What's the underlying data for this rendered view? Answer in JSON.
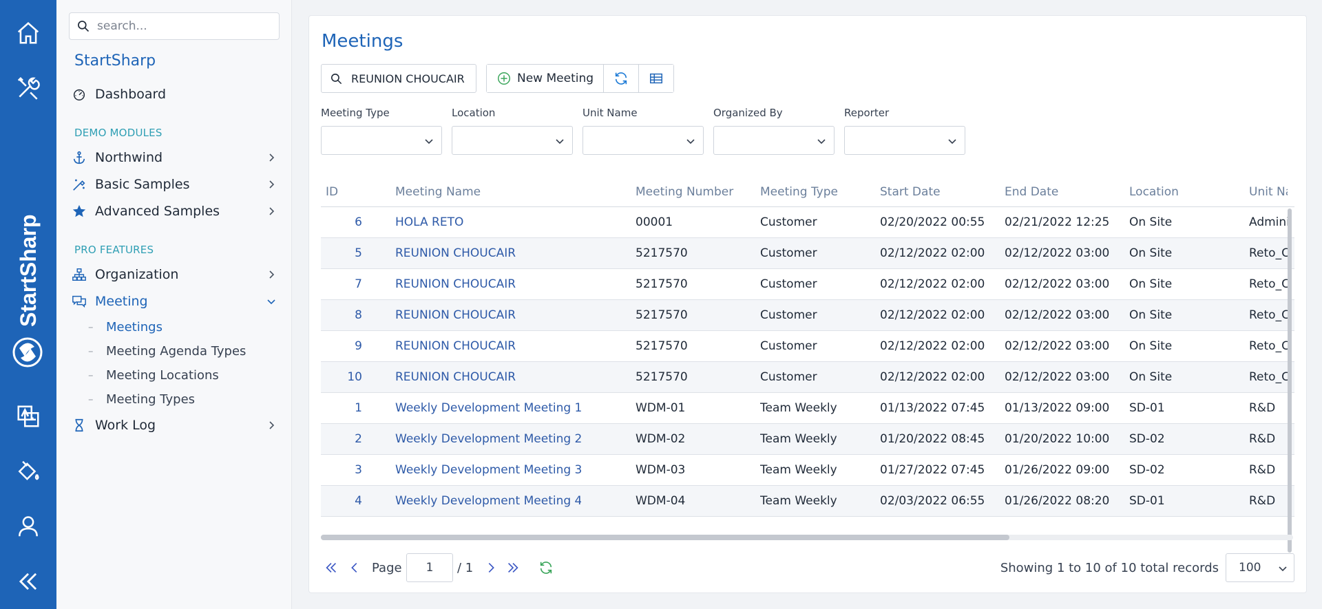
{
  "rail": {
    "brand_text": "StartSharp",
    "icons": [
      "home-icon",
      "tools-icon",
      "translate-icon",
      "paint-bucket-icon",
      "user-icon",
      "collapse-icon"
    ]
  },
  "sidebar": {
    "search_placeholder": "search...",
    "app_title": "StartSharp",
    "dashboard": "Dashboard",
    "section_demo": "DEMO MODULES",
    "northwind": "Northwind",
    "basic_samples": "Basic Samples",
    "advanced_samples": "Advanced Samples",
    "section_pro": "PRO FEATURES",
    "organization": "Organization",
    "meeting": "Meeting",
    "meeting_sub": [
      "Meetings",
      "Meeting Agenda Types",
      "Meeting Locations",
      "Meeting Types"
    ],
    "work_log": "Work Log"
  },
  "main": {
    "title": "Meetings",
    "search_value": "REUNION CHOUCAIR",
    "new_button": "New Meeting",
    "filters": [
      "Meeting Type",
      "Location",
      "Unit Name",
      "Organized By",
      "Reporter"
    ],
    "columns": [
      "ID",
      "Meeting Name",
      "Meeting Number",
      "Meeting Type",
      "Start Date",
      "End Date",
      "Location",
      "Unit Name"
    ],
    "rows": [
      {
        "id": "6",
        "name": "HOLA RETO",
        "number": "00001",
        "type": "Customer",
        "start": "02/20/2022 00:55",
        "end": "02/21/2022 12:25",
        "location": "On Site",
        "unit": "Administration"
      },
      {
        "id": "5",
        "name": "REUNION CHOUCAIR",
        "number": "5217570",
        "type": "Customer",
        "start": "02/12/2022 02:00",
        "end": "02/12/2022 03:00",
        "location": "On Site",
        "unit": "Reto_Choucair"
      },
      {
        "id": "7",
        "name": "REUNION CHOUCAIR",
        "number": "5217570",
        "type": "Customer",
        "start": "02/12/2022 02:00",
        "end": "02/12/2022 03:00",
        "location": "On Site",
        "unit": "Reto_Choucair"
      },
      {
        "id": "8",
        "name": "REUNION CHOUCAIR",
        "number": "5217570",
        "type": "Customer",
        "start": "02/12/2022 02:00",
        "end": "02/12/2022 03:00",
        "location": "On Site",
        "unit": "Reto_Choucair"
      },
      {
        "id": "9",
        "name": "REUNION CHOUCAIR",
        "number": "5217570",
        "type": "Customer",
        "start": "02/12/2022 02:00",
        "end": "02/12/2022 03:00",
        "location": "On Site",
        "unit": "Reto_Choucair"
      },
      {
        "id": "10",
        "name": "REUNION CHOUCAIR",
        "number": "5217570",
        "type": "Customer",
        "start": "02/12/2022 02:00",
        "end": "02/12/2022 03:00",
        "location": "On Site",
        "unit": "Reto_Choucair"
      },
      {
        "id": "1",
        "name": "Weekly Development Meeting 1",
        "number": "WDM-01",
        "type": "Team Weekly",
        "start": "01/13/2022 07:45",
        "end": "01/13/2022 09:00",
        "location": "SD-01",
        "unit": "R&D"
      },
      {
        "id": "2",
        "name": "Weekly Development Meeting 2",
        "number": "WDM-02",
        "type": "Team Weekly",
        "start": "01/20/2022 08:45",
        "end": "01/20/2022 10:00",
        "location": "SD-02",
        "unit": "R&D"
      },
      {
        "id": "3",
        "name": "Weekly Development Meeting 3",
        "number": "WDM-03",
        "type": "Team Weekly",
        "start": "01/27/2022 07:45",
        "end": "01/26/2022 09:00",
        "location": "SD-02",
        "unit": "R&D"
      },
      {
        "id": "4",
        "name": "Weekly Development Meeting 4",
        "number": "WDM-04",
        "type": "Team Weekly",
        "start": "02/03/2022 06:55",
        "end": "01/26/2022 08:20",
        "location": "SD-01",
        "unit": "R&D"
      }
    ]
  },
  "pager": {
    "page_label": "Page",
    "page_value": "1",
    "page_total": "/ 1",
    "info": "Showing 1 to 10 of 10 total records",
    "page_size": "100"
  },
  "colors": {
    "brand": "#1e64b7",
    "section": "#2f9fb4",
    "link": "#2e5aa8",
    "add_green": "#3aa55a"
  }
}
